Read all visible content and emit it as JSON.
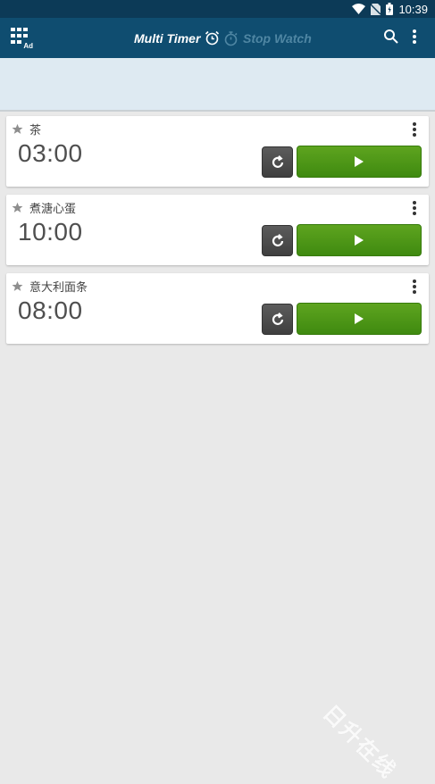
{
  "status_bar": {
    "time": "10:39",
    "icons": [
      "wifi-icon",
      "no-sim-icon",
      "battery-icon"
    ]
  },
  "appbar": {
    "ad_label": "Ad",
    "tabs": [
      {
        "label": "Multi Timer",
        "icon": "alarm-clock-icon",
        "active": true
      },
      {
        "label": "Stop Watch",
        "icon": "stopwatch-icon",
        "active": false
      }
    ],
    "actions": [
      "search-icon",
      "overflow-menu-icon"
    ]
  },
  "colors": {
    "status_bar": "#0c3a57",
    "appbar": "#0f4d70",
    "tab_indicator": "#d4ef2b",
    "play_button": "#4c9617",
    "reset_button": "#4a4a4a"
  },
  "timers": [
    {
      "name": "茶",
      "time": "03:00"
    },
    {
      "name": "煮溏心蛋",
      "time": "10:00"
    },
    {
      "name": "意大利面条",
      "time": "08:00"
    }
  ],
  "watermark": "日升在线"
}
